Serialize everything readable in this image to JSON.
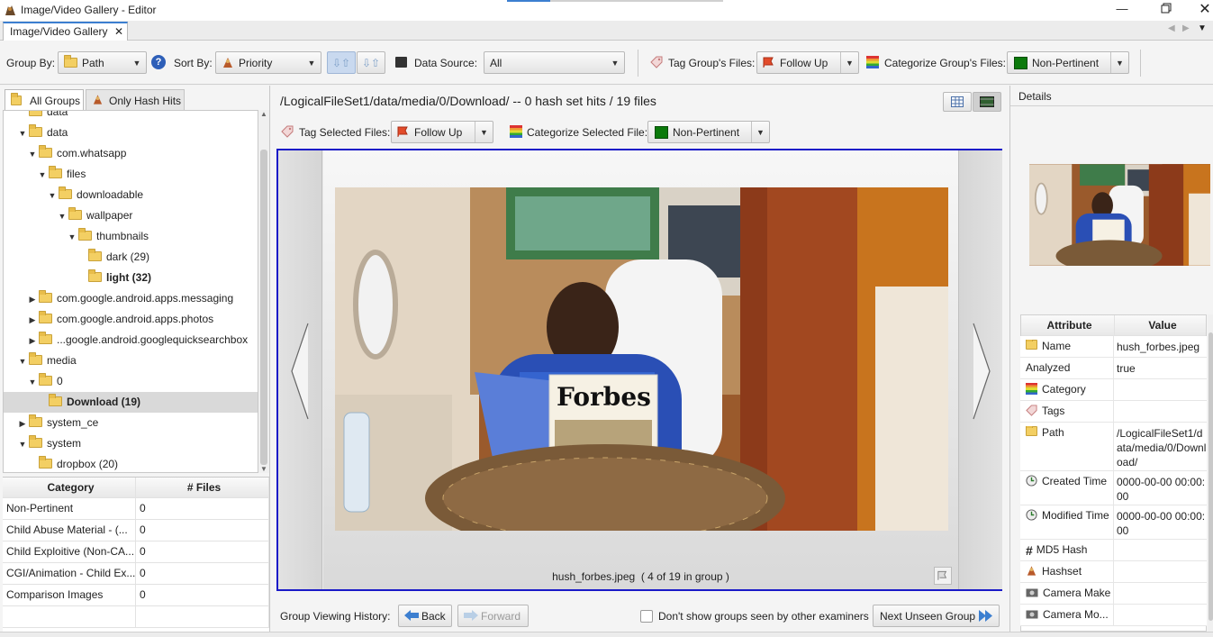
{
  "window": {
    "title": "Image/Video Gallery - Editor",
    "tab_label": "Image/Video Gallery"
  },
  "toolbar": {
    "group_by_label": "Group By:",
    "group_by_value": "Path",
    "sort_by_label": "Sort By:",
    "sort_by_value": "Priority",
    "data_source_label": "Data Source:",
    "data_source_value": "All",
    "tag_group_label": "Tag Group's Files:",
    "tag_group_value": "Follow Up",
    "categorize_group_label": "Categorize Group's Files:",
    "categorize_group_value": "Non-Pertinent"
  },
  "left_tabs": {
    "all_groups": "All Groups",
    "only_hash_hits": "Only Hash Hits"
  },
  "tree": [
    {
      "label": "data",
      "depth": 0,
      "toggle": "▼",
      "bold": false
    },
    {
      "label": "com.whatsapp",
      "depth": 1,
      "toggle": "▼",
      "bold": false
    },
    {
      "label": "files",
      "depth": 2,
      "toggle": "▼",
      "bold": false
    },
    {
      "label": "downloadable",
      "depth": 3,
      "toggle": "▼",
      "bold": false
    },
    {
      "label": "wallpaper",
      "depth": 4,
      "toggle": "▼",
      "bold": false
    },
    {
      "label": "thumbnails",
      "depth": 5,
      "toggle": "▼",
      "bold": false
    },
    {
      "label": "dark (29)",
      "depth": 6,
      "toggle": "",
      "bold": false
    },
    {
      "label": "light (32)",
      "depth": 6,
      "toggle": "",
      "bold": true
    },
    {
      "label": "com.google.android.apps.messaging",
      "depth": 1,
      "toggle": "▶",
      "bold": false
    },
    {
      "label": "com.google.android.apps.photos",
      "depth": 1,
      "toggle": "▶",
      "bold": false
    },
    {
      "label": "...google.android.googlequicksearchbox",
      "depth": 1,
      "toggle": "▶",
      "bold": false
    },
    {
      "label": "media",
      "depth": 0,
      "toggle": "▼",
      "bold": false
    },
    {
      "label": "0",
      "depth": 1,
      "toggle": "▼",
      "bold": false
    },
    {
      "label": "Download (19)",
      "depth": 2,
      "toggle": "",
      "bold": true,
      "selected": true
    },
    {
      "label": "system_ce",
      "depth": 0,
      "toggle": "▶",
      "bold": false
    },
    {
      "label": "system",
      "depth": 0,
      "toggle": "▼",
      "bold": false
    },
    {
      "label": "dropbox (20)",
      "depth": 1,
      "toggle": "",
      "bold": false
    }
  ],
  "tree_partial_top": "data",
  "category_table": {
    "headers": [
      "Category",
      "# Files"
    ],
    "rows": [
      [
        "Non-Pertinent",
        "0"
      ],
      [
        "Child Abuse Material - (...",
        "0"
      ],
      [
        "Child Exploitive (Non-CA...",
        "0"
      ],
      [
        "CGI/Animation - Child Ex...",
        "0"
      ],
      [
        "Comparison Images",
        "0"
      ]
    ]
  },
  "center": {
    "header": "/LogicalFileSet1/data/media/0/Download/  -- 0 hash set hits / 19 files",
    "tag_selected_label": "Tag Selected Files:",
    "tag_selected_value": "Follow Up",
    "categorize_selected_label": "Categorize Selected File:",
    "categorize_selected_value": "Non-Pertinent",
    "caption": "hush_forbes.jpeg  ( 4 of 19 in group )",
    "magazine_text": "Forbes"
  },
  "bottom": {
    "history_label": "Group Viewing History:",
    "back": "Back",
    "forward": "Forward",
    "dont_show": "Don't show groups seen by other examiners",
    "next_unseen": "Next Unseen Group"
  },
  "details": {
    "title": "Details",
    "headers": [
      "Attribute",
      "Value"
    ],
    "rows": [
      {
        "attr": "Name",
        "value": "hush_forbes.jpeg",
        "icon": "file-icon"
      },
      {
        "attr": "Analyzed",
        "value": "true",
        "icon": ""
      },
      {
        "attr": "Category",
        "value": "",
        "icon": "category-icon"
      },
      {
        "attr": "Tags",
        "value": "",
        "icon": "tag-icon"
      },
      {
        "attr": "Path",
        "value": "/LogicalFileSet1/data/media/0/Download/",
        "icon": "folder-icon"
      },
      {
        "attr": "Created Time",
        "value": "0000-00-00 00:00:00",
        "icon": "clock-icon"
      },
      {
        "attr": "Modified Time",
        "value": "0000-00-00 00:00:00",
        "icon": "clock-icon"
      },
      {
        "attr": "MD5 Hash",
        "value": "",
        "icon": "hash-icon"
      },
      {
        "attr": "Hashset",
        "value": "",
        "icon": "hashset-icon"
      },
      {
        "attr": "Camera Make",
        "value": "",
        "icon": "camera-icon"
      },
      {
        "attr": "Camera Mo...",
        "value": "",
        "icon": "camera-icon"
      }
    ]
  },
  "colors": {
    "selection_border": "#1a1ac8",
    "non_pertinent": "#0b7a0b",
    "accent": "#3c7fd0"
  }
}
